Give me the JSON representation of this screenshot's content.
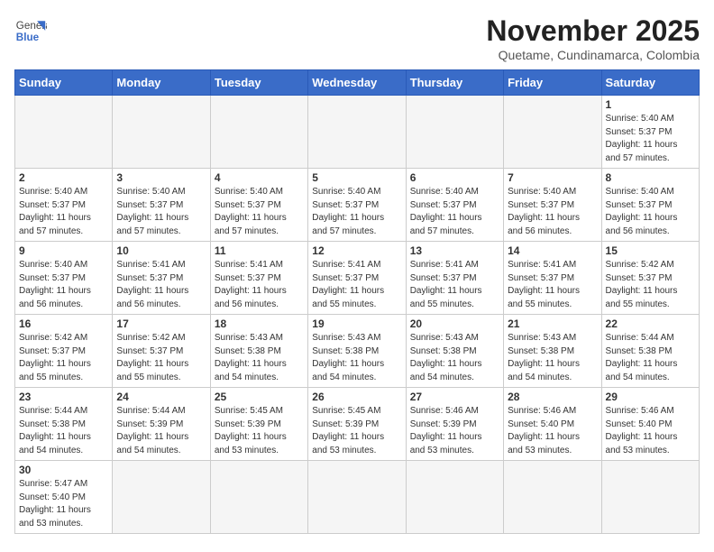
{
  "logo": {
    "text_general": "General",
    "text_blue": "Blue"
  },
  "title": "November 2025",
  "location": "Quetame, Cundinamarca, Colombia",
  "weekdays": [
    "Sunday",
    "Monday",
    "Tuesday",
    "Wednesday",
    "Thursday",
    "Friday",
    "Saturday"
  ],
  "weeks": [
    [
      {
        "day": "",
        "info": ""
      },
      {
        "day": "",
        "info": ""
      },
      {
        "day": "",
        "info": ""
      },
      {
        "day": "",
        "info": ""
      },
      {
        "day": "",
        "info": ""
      },
      {
        "day": "",
        "info": ""
      },
      {
        "day": "1",
        "info": "Sunrise: 5:40 AM\nSunset: 5:37 PM\nDaylight: 11 hours\nand 57 minutes."
      }
    ],
    [
      {
        "day": "2",
        "info": "Sunrise: 5:40 AM\nSunset: 5:37 PM\nDaylight: 11 hours\nand 57 minutes."
      },
      {
        "day": "3",
        "info": "Sunrise: 5:40 AM\nSunset: 5:37 PM\nDaylight: 11 hours\nand 57 minutes."
      },
      {
        "day": "4",
        "info": "Sunrise: 5:40 AM\nSunset: 5:37 PM\nDaylight: 11 hours\nand 57 minutes."
      },
      {
        "day": "5",
        "info": "Sunrise: 5:40 AM\nSunset: 5:37 PM\nDaylight: 11 hours\nand 57 minutes."
      },
      {
        "day": "6",
        "info": "Sunrise: 5:40 AM\nSunset: 5:37 PM\nDaylight: 11 hours\nand 57 minutes."
      },
      {
        "day": "7",
        "info": "Sunrise: 5:40 AM\nSunset: 5:37 PM\nDaylight: 11 hours\nand 56 minutes."
      },
      {
        "day": "8",
        "info": "Sunrise: 5:40 AM\nSunset: 5:37 PM\nDaylight: 11 hours\nand 56 minutes."
      }
    ],
    [
      {
        "day": "9",
        "info": "Sunrise: 5:40 AM\nSunset: 5:37 PM\nDaylight: 11 hours\nand 56 minutes."
      },
      {
        "day": "10",
        "info": "Sunrise: 5:41 AM\nSunset: 5:37 PM\nDaylight: 11 hours\nand 56 minutes."
      },
      {
        "day": "11",
        "info": "Sunrise: 5:41 AM\nSunset: 5:37 PM\nDaylight: 11 hours\nand 56 minutes."
      },
      {
        "day": "12",
        "info": "Sunrise: 5:41 AM\nSunset: 5:37 PM\nDaylight: 11 hours\nand 55 minutes."
      },
      {
        "day": "13",
        "info": "Sunrise: 5:41 AM\nSunset: 5:37 PM\nDaylight: 11 hours\nand 55 minutes."
      },
      {
        "day": "14",
        "info": "Sunrise: 5:41 AM\nSunset: 5:37 PM\nDaylight: 11 hours\nand 55 minutes."
      },
      {
        "day": "15",
        "info": "Sunrise: 5:42 AM\nSunset: 5:37 PM\nDaylight: 11 hours\nand 55 minutes."
      }
    ],
    [
      {
        "day": "16",
        "info": "Sunrise: 5:42 AM\nSunset: 5:37 PM\nDaylight: 11 hours\nand 55 minutes."
      },
      {
        "day": "17",
        "info": "Sunrise: 5:42 AM\nSunset: 5:37 PM\nDaylight: 11 hours\nand 55 minutes."
      },
      {
        "day": "18",
        "info": "Sunrise: 5:43 AM\nSunset: 5:38 PM\nDaylight: 11 hours\nand 54 minutes."
      },
      {
        "day": "19",
        "info": "Sunrise: 5:43 AM\nSunset: 5:38 PM\nDaylight: 11 hours\nand 54 minutes."
      },
      {
        "day": "20",
        "info": "Sunrise: 5:43 AM\nSunset: 5:38 PM\nDaylight: 11 hours\nand 54 minutes."
      },
      {
        "day": "21",
        "info": "Sunrise: 5:43 AM\nSunset: 5:38 PM\nDaylight: 11 hours\nand 54 minutes."
      },
      {
        "day": "22",
        "info": "Sunrise: 5:44 AM\nSunset: 5:38 PM\nDaylight: 11 hours\nand 54 minutes."
      }
    ],
    [
      {
        "day": "23",
        "info": "Sunrise: 5:44 AM\nSunset: 5:38 PM\nDaylight: 11 hours\nand 54 minutes."
      },
      {
        "day": "24",
        "info": "Sunrise: 5:44 AM\nSunset: 5:39 PM\nDaylight: 11 hours\nand 54 minutes."
      },
      {
        "day": "25",
        "info": "Sunrise: 5:45 AM\nSunset: 5:39 PM\nDaylight: 11 hours\nand 53 minutes."
      },
      {
        "day": "26",
        "info": "Sunrise: 5:45 AM\nSunset: 5:39 PM\nDaylight: 11 hours\nand 53 minutes."
      },
      {
        "day": "27",
        "info": "Sunrise: 5:46 AM\nSunset: 5:39 PM\nDaylight: 11 hours\nand 53 minutes."
      },
      {
        "day": "28",
        "info": "Sunrise: 5:46 AM\nSunset: 5:40 PM\nDaylight: 11 hours\nand 53 minutes."
      },
      {
        "day": "29",
        "info": "Sunrise: 5:46 AM\nSunset: 5:40 PM\nDaylight: 11 hours\nand 53 minutes."
      }
    ],
    [
      {
        "day": "30",
        "info": "Sunrise: 5:47 AM\nSunset: 5:40 PM\nDaylight: 11 hours\nand 53 minutes."
      },
      {
        "day": "",
        "info": ""
      },
      {
        "day": "",
        "info": ""
      },
      {
        "day": "",
        "info": ""
      },
      {
        "day": "",
        "info": ""
      },
      {
        "day": "",
        "info": ""
      },
      {
        "day": "",
        "info": ""
      }
    ]
  ]
}
